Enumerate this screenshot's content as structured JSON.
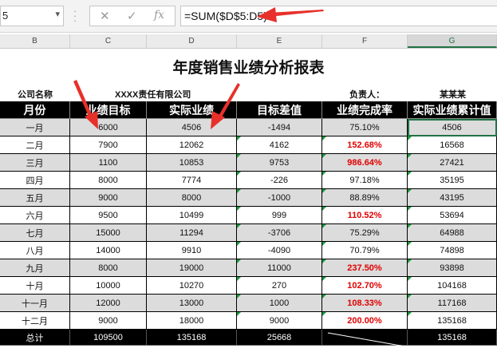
{
  "namebox": {
    "value": "5"
  },
  "formula_bar": {
    "cancel_icon": "✕",
    "enter_icon": "✓",
    "fx_icon": "fx",
    "formula": "=SUM($D$5:D5)"
  },
  "columns": [
    "B",
    "C",
    "D",
    "E",
    "F",
    "G"
  ],
  "sheet": {
    "title": "年度销售业绩分析报表",
    "company_label": "公司名称",
    "company_name": "XXXX责任有限公司",
    "manager_label": "负责人：",
    "manager_name": "某某某",
    "headers": [
      "月份",
      "业绩目标",
      "实际业绩",
      "目标差值",
      "业绩完成率",
      "实际业绩累计值"
    ],
    "rows": [
      {
        "month": "一月",
        "target": "6000",
        "actual": "4506",
        "diff": "-1494",
        "rate": "75.10%",
        "cum": "4506",
        "high": false
      },
      {
        "month": "二月",
        "target": "7900",
        "actual": "12062",
        "diff": "4162",
        "rate": "152.68%",
        "cum": "16568",
        "high": true
      },
      {
        "month": "三月",
        "target": "1100",
        "actual": "10853",
        "diff": "9753",
        "rate": "986.64%",
        "cum": "27421",
        "high": true
      },
      {
        "month": "四月",
        "target": "8000",
        "actual": "7774",
        "diff": "-226",
        "rate": "97.18%",
        "cum": "35195",
        "high": false
      },
      {
        "month": "五月",
        "target": "9000",
        "actual": "8000",
        "diff": "-1000",
        "rate": "88.89%",
        "cum": "43195",
        "high": false
      },
      {
        "month": "六月",
        "target": "9500",
        "actual": "10499",
        "diff": "999",
        "rate": "110.52%",
        "cum": "53694",
        "high": true
      },
      {
        "month": "七月",
        "target": "15000",
        "actual": "11294",
        "diff": "-3706",
        "rate": "75.29%",
        "cum": "64988",
        "high": false
      },
      {
        "month": "八月",
        "target": "14000",
        "actual": "9910",
        "diff": "-4090",
        "rate": "70.79%",
        "cum": "74898",
        "high": false
      },
      {
        "month": "九月",
        "target": "8000",
        "actual": "19000",
        "diff": "11000",
        "rate": "237.50%",
        "cum": "93898",
        "high": true
      },
      {
        "month": "十月",
        "target": "10000",
        "actual": "10270",
        "diff": "270",
        "rate": "102.70%",
        "cum": "104168",
        "high": true
      },
      {
        "month": "十一月",
        "target": "12000",
        "actual": "13000",
        "diff": "1000",
        "rate": "108.33%",
        "cum": "117168",
        "high": true
      },
      {
        "month": "十二月",
        "target": "9000",
        "actual": "18000",
        "diff": "9000",
        "rate": "200.00%",
        "cum": "135168",
        "high": true
      }
    ],
    "total": {
      "label": "总计",
      "target": "109500",
      "actual": "135168",
      "diff": "25668",
      "rate": "",
      "cum": "135168"
    }
  },
  "colors": {
    "highlight_red": "#e00000",
    "header_black": "#000000",
    "row_gray": "#dcdcdc",
    "arrow_red": "#e8302a",
    "excel_green": "#217346"
  }
}
